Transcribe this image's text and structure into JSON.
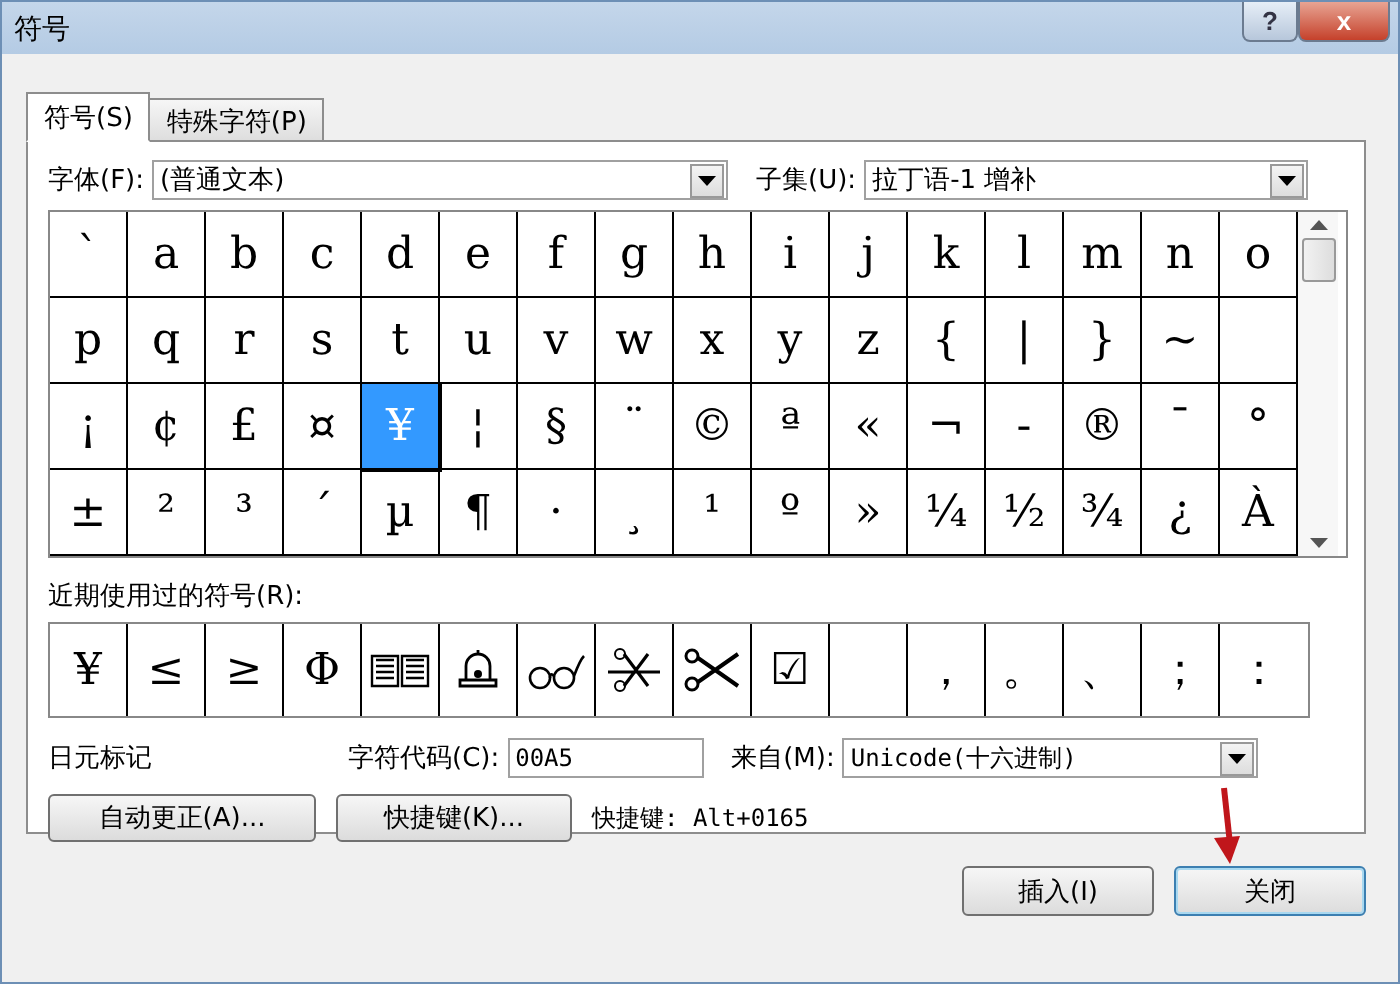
{
  "window": {
    "title": "符号",
    "help_button": "?",
    "close_button": "x"
  },
  "tabs": [
    {
      "label": "符号(S)",
      "selected": true
    },
    {
      "label": "特殊字符(P)",
      "selected": false
    }
  ],
  "font": {
    "label": "字体(F):",
    "value": "(普通文本)"
  },
  "subset": {
    "label": "子集(U):",
    "value": "拉丁语-1 增补"
  },
  "grid": [
    [
      {
        "glyph": "`",
        "selected": false
      },
      {
        "glyph": "a",
        "selected": false
      },
      {
        "glyph": "b",
        "selected": false
      },
      {
        "glyph": "c",
        "selected": false
      },
      {
        "glyph": "d",
        "selected": false
      },
      {
        "glyph": "e",
        "selected": false
      },
      {
        "glyph": "f",
        "selected": false
      },
      {
        "glyph": "g",
        "selected": false
      },
      {
        "glyph": "h",
        "selected": false
      },
      {
        "glyph": "i",
        "selected": false
      },
      {
        "glyph": "j",
        "selected": false
      },
      {
        "glyph": "k",
        "selected": false
      },
      {
        "glyph": "l",
        "selected": false
      },
      {
        "glyph": "m",
        "selected": false
      },
      {
        "glyph": "n",
        "selected": false
      },
      {
        "glyph": "o",
        "selected": false
      }
    ],
    [
      {
        "glyph": "p",
        "selected": false
      },
      {
        "glyph": "q",
        "selected": false
      },
      {
        "glyph": "r",
        "selected": false
      },
      {
        "glyph": "s",
        "selected": false
      },
      {
        "glyph": "t",
        "selected": false
      },
      {
        "glyph": "u",
        "selected": false
      },
      {
        "glyph": "v",
        "selected": false
      },
      {
        "glyph": "w",
        "selected": false
      },
      {
        "glyph": "x",
        "selected": false
      },
      {
        "glyph": "y",
        "selected": false
      },
      {
        "glyph": "z",
        "selected": false
      },
      {
        "glyph": "{",
        "selected": false
      },
      {
        "glyph": "|",
        "selected": false
      },
      {
        "glyph": "}",
        "selected": false
      },
      {
        "glyph": "~",
        "selected": false
      },
      {
        "selected": false
      }
    ],
    [
      {
        "glyph": "¡",
        "selected": false
      },
      {
        "glyph": "¢",
        "selected": false
      },
      {
        "glyph": "£",
        "selected": false
      },
      {
        "glyph": "¤",
        "selected": false
      },
      {
        "glyph": "¥",
        "selected": true
      },
      {
        "glyph": "¦",
        "selected": false
      },
      {
        "glyph": "§",
        "selected": false
      },
      {
        "glyph": "¨",
        "selected": false
      },
      {
        "glyph": "©",
        "selected": false
      },
      {
        "glyph": "ª",
        "selected": false
      },
      {
        "glyph": "«",
        "selected": false
      },
      {
        "glyph": "¬",
        "selected": false
      },
      {
        "glyph": "-",
        "selected": false
      },
      {
        "glyph": "®",
        "selected": false
      },
      {
        "glyph": "¯",
        "selected": false
      },
      {
        "glyph": "°",
        "selected": false
      }
    ],
    [
      {
        "glyph": "±",
        "selected": false
      },
      {
        "glyph": "²",
        "selected": false
      },
      {
        "glyph": "³",
        "selected": false
      },
      {
        "glyph": "´",
        "selected": false
      },
      {
        "glyph": "µ",
        "selected": false
      },
      {
        "glyph": "¶",
        "selected": false
      },
      {
        "glyph": "·",
        "selected": false
      },
      {
        "glyph": "¸",
        "selected": false
      },
      {
        "glyph": "¹",
        "selected": false
      },
      {
        "glyph": "º",
        "selected": false
      },
      {
        "glyph": "»",
        "selected": false
      },
      {
        "glyph": "¼",
        "selected": false
      },
      {
        "glyph": "½",
        "selected": false
      },
      {
        "glyph": "¾",
        "selected": false
      },
      {
        "glyph": "¿",
        "selected": false
      },
      {
        "glyph": "À",
        "selected": false
      }
    ]
  ],
  "recent": {
    "label": "近期使用过的符号(R):",
    "items": [
      {
        "kind": "glyph",
        "glyph": "¥"
      },
      {
        "kind": "glyph",
        "glyph": "≤"
      },
      {
        "kind": "glyph",
        "glyph": "≥"
      },
      {
        "kind": "glyph",
        "glyph": "Φ"
      },
      {
        "kind": "book"
      },
      {
        "kind": "bell"
      },
      {
        "kind": "glasses"
      },
      {
        "kind": "cutline"
      },
      {
        "kind": "scissors"
      },
      {
        "kind": "glyph",
        "glyph": "☑"
      },
      {
        "kind": "empty"
      },
      {
        "kind": "glyph",
        "glyph": "，"
      },
      {
        "kind": "glyph",
        "glyph": "。"
      },
      {
        "kind": "glyph",
        "glyph": "、"
      },
      {
        "kind": "glyph",
        "glyph": "；"
      },
      {
        "kind": "glyph",
        "glyph": "："
      }
    ]
  },
  "symbol_name": "日元标记",
  "char_code": {
    "label": "字符代码(C):",
    "value": "00A5"
  },
  "from": {
    "label": "来自(M):",
    "value": "Unicode(十六进制)"
  },
  "autocorrect_button": "自动更正(A)...",
  "shortcut_button": "快捷键(K)...",
  "shortcut_text": "快捷键: Alt+0165",
  "buttons": [
    {
      "label": "插入(I)",
      "selected": false
    },
    {
      "label": "关闭",
      "selected": true
    }
  ]
}
